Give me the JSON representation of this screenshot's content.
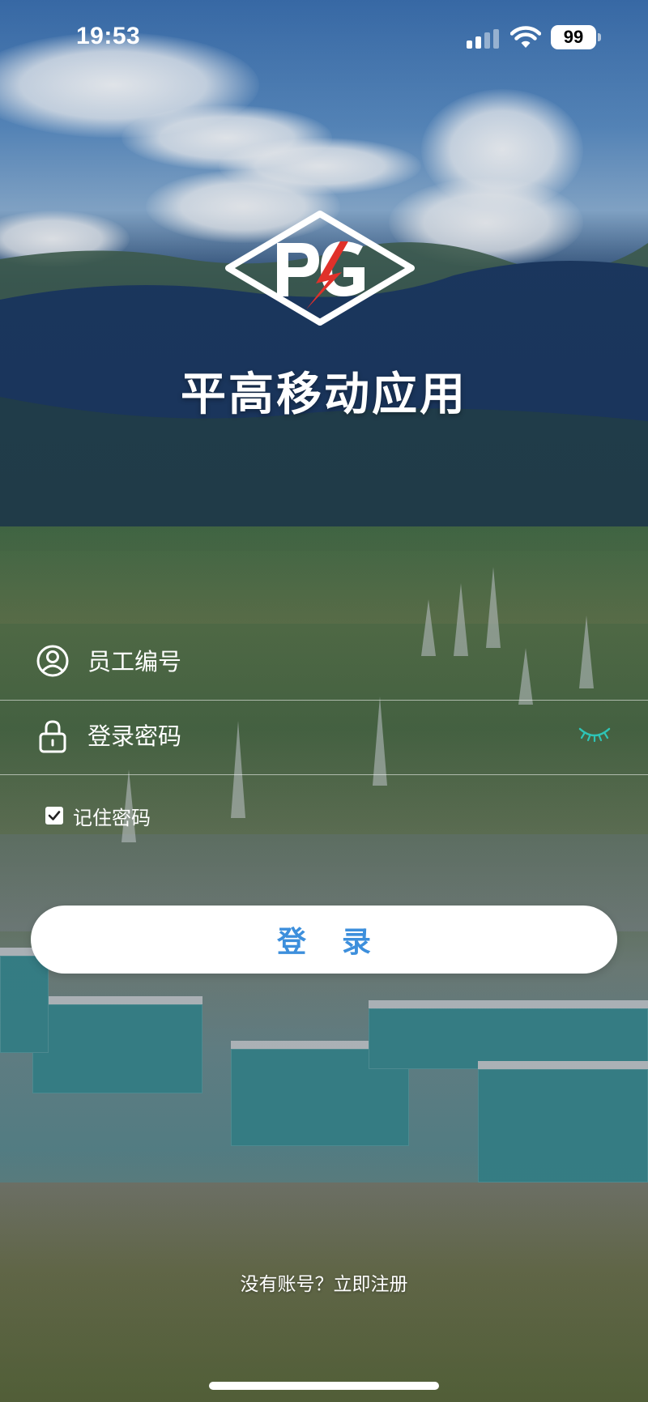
{
  "status_bar": {
    "time": "19:53",
    "battery": "99",
    "icons": [
      "signal-icon",
      "wifi-icon",
      "battery-icon"
    ]
  },
  "app": {
    "title": "平高移动应用",
    "logo": "PG-logo"
  },
  "form": {
    "employee_id_placeholder": "员工编号",
    "employee_id_value": "",
    "password_placeholder": "登录密码",
    "password_value": "",
    "remember_label": "记住密码",
    "remember_checked": true
  },
  "actions": {
    "login_label": "登录",
    "register_text": "没有账号？立即注册"
  },
  "colors": {
    "accent": "#3d8fdc",
    "logo_red": "#e0312a",
    "text": "#ffffff"
  }
}
